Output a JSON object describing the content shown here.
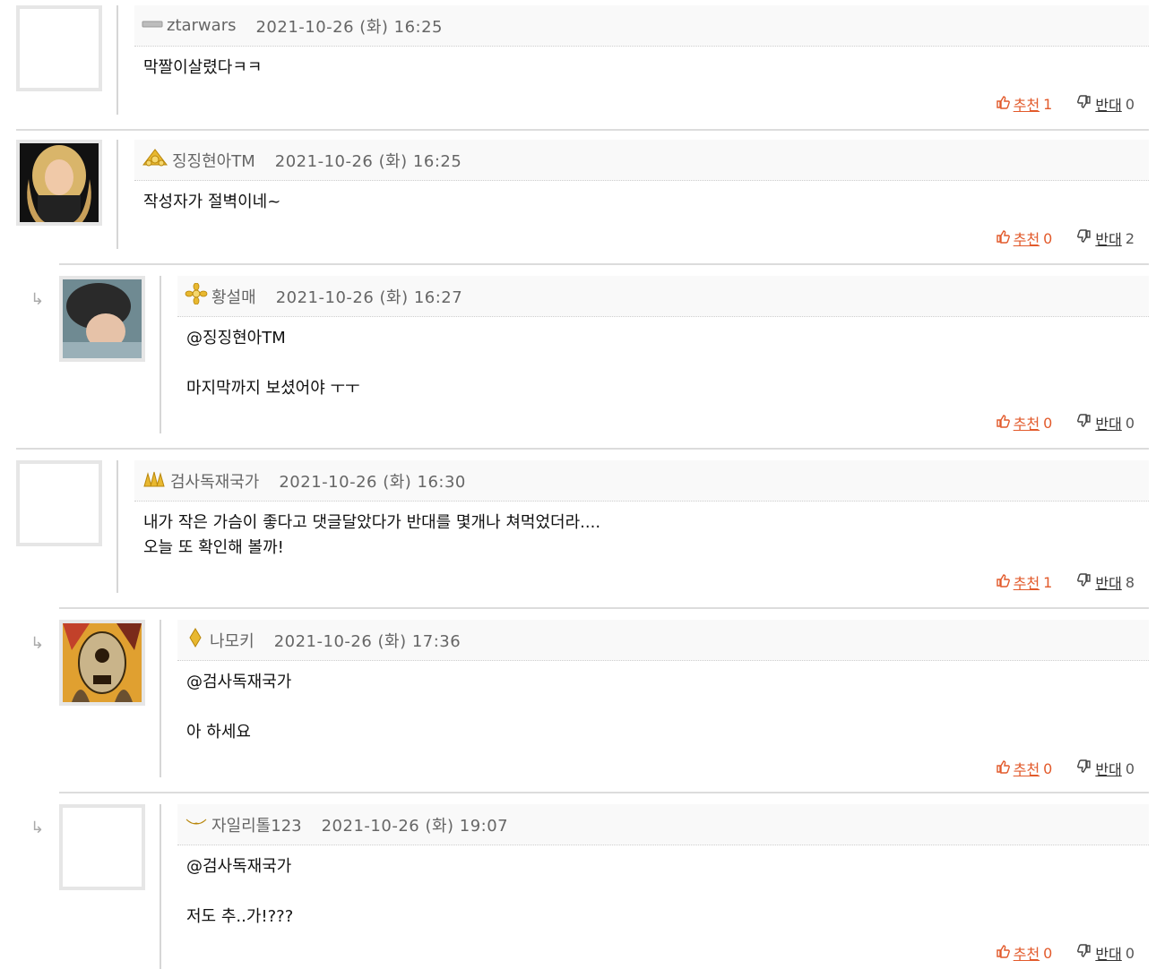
{
  "comments": [
    {
      "nick": "ztarwars",
      "level_icon": "level-bar-icon",
      "date": "2021-10-26 (화) 16:25",
      "body": "막짤이살렸다ㅋㅋ",
      "recommend_label": "추천",
      "recommend_count": "1",
      "oppose_label": "반대",
      "oppose_count": "0",
      "avatar": "empty"
    },
    {
      "nick": "징징현아TM",
      "level_icon": "gold-crown-icon",
      "date": "2021-10-26 (화) 16:25",
      "body": "작성자가 절벽이네~",
      "recommend_label": "추천",
      "recommend_count": "0",
      "oppose_label": "반대",
      "oppose_count": "2",
      "avatar": "photo-blonde-woman"
    },
    {
      "nick": "황설매",
      "level_icon": "gold-flower-icon",
      "date": "2021-10-26 (화) 16:27",
      "body_mention": "@징징현아TM",
      "body": "마지막까지 보셨어야 ㅜㅜ",
      "recommend_label": "추천",
      "recommend_count": "0",
      "oppose_label": "반대",
      "oppose_count": "0",
      "avatar": "photo-face",
      "reply_arrow": "↳"
    },
    {
      "nick": "검사독재국가",
      "level_icon": "gold-triple-icon",
      "date": "2021-10-26 (화) 16:30",
      "body": "내가 작은 가슴이 좋다고 댓글달았다가 반대를 몇개나 쳐먹었더라....\n오늘 또 확인해 볼까!",
      "recommend_label": "추천",
      "recommend_count": "1",
      "oppose_label": "반대",
      "oppose_count": "8",
      "avatar": "empty"
    },
    {
      "nick": "나모키",
      "level_icon": "gold-diamond-icon",
      "date": "2021-10-26 (화) 17:36",
      "body_mention": "@검사독재국가",
      "body": "아 하세요",
      "recommend_label": "추천",
      "recommend_count": "0",
      "oppose_label": "반대",
      "oppose_count": "0",
      "avatar": "photo-masked-character",
      "reply_arrow": "↳"
    },
    {
      "nick": "자일리톨123",
      "level_icon": "gold-wing-icon",
      "date": "2021-10-26 (화) 19:07",
      "body_mention": "@검사독재국가",
      "body": "저도 추..가!???",
      "recommend_label": "추천",
      "recommend_count": "0",
      "oppose_label": "반대",
      "oppose_count": "0",
      "avatar": "empty",
      "reply_arrow": "↳"
    }
  ],
  "colors": {
    "recommend": "#e25a2b",
    "header_bg": "#f9f9f9",
    "separator": "#dcdcdc"
  }
}
